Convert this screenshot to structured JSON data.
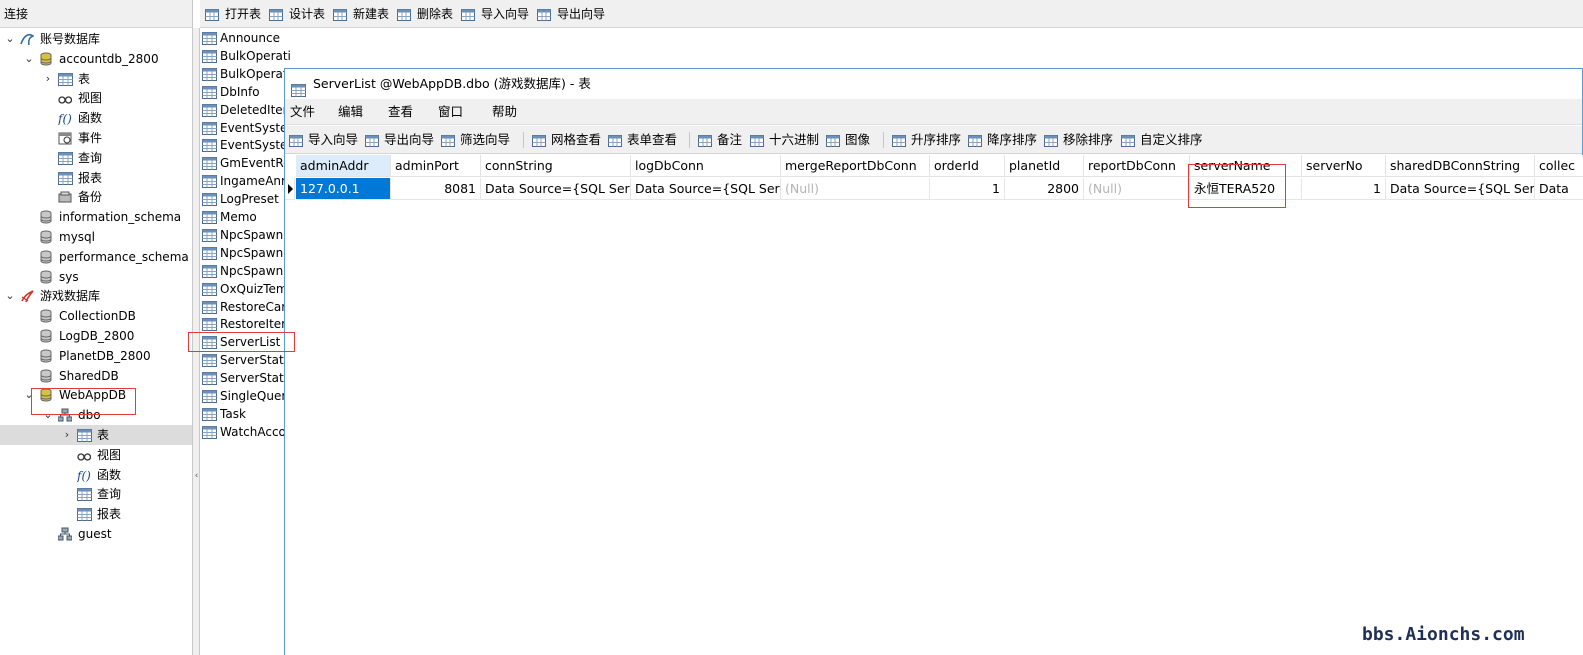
{
  "left_panel": {
    "header": "连接",
    "tree": [
      {
        "label": "账号数据库",
        "level": 0,
        "expanded": true,
        "icon": "mysql-connection-icon"
      },
      {
        "label": "accountdb_2800",
        "level": 1,
        "expanded": true,
        "icon": "database-open-icon"
      },
      {
        "label": "表",
        "level": 2,
        "expanded": false,
        "icon": "tables-icon"
      },
      {
        "label": "视图",
        "level": 2,
        "icon": "views-icon"
      },
      {
        "label": "函数",
        "level": 2,
        "icon": "functions-icon"
      },
      {
        "label": "事件",
        "level": 2,
        "icon": "events-icon"
      },
      {
        "label": "查询",
        "level": 2,
        "icon": "queries-icon"
      },
      {
        "label": "报表",
        "level": 2,
        "icon": "reports-icon"
      },
      {
        "label": "备份",
        "level": 2,
        "icon": "backups-icon"
      },
      {
        "label": "information_schema",
        "level": 1,
        "icon": "database-icon"
      },
      {
        "label": "mysql",
        "level": 1,
        "icon": "database-icon"
      },
      {
        "label": "performance_schema",
        "level": 1,
        "icon": "database-icon"
      },
      {
        "label": "sys",
        "level": 1,
        "icon": "database-icon"
      },
      {
        "label": "游戏数据库",
        "level": 0,
        "expanded": true,
        "icon": "sqlserver-connection-icon"
      },
      {
        "label": "CollectionDB",
        "level": 1,
        "icon": "database-icon"
      },
      {
        "label": "LogDB_2800",
        "level": 1,
        "icon": "database-icon"
      },
      {
        "label": "PlanetDB_2800",
        "level": 1,
        "icon": "database-icon"
      },
      {
        "label": "SharedDB",
        "level": 1,
        "icon": "database-icon"
      },
      {
        "label": "WebAppDB",
        "level": 1,
        "expanded": true,
        "icon": "database-open-icon"
      },
      {
        "label": "dbo",
        "level": 2,
        "expanded": true,
        "icon": "schema-icon"
      },
      {
        "label": "表",
        "level": 3,
        "expanded": false,
        "selected": true,
        "icon": "tables-icon"
      },
      {
        "label": "视图",
        "level": 3,
        "icon": "views-icon"
      },
      {
        "label": "函数",
        "level": 3,
        "icon": "functions-icon"
      },
      {
        "label": "查询",
        "level": 3,
        "icon": "queries-icon"
      },
      {
        "label": "报表",
        "level": 3,
        "icon": "reports-icon"
      },
      {
        "label": "guest",
        "level": 2,
        "icon": "schema-icon"
      }
    ]
  },
  "main_toolbar": [
    {
      "label": "打开表",
      "icon": "open-table-icon"
    },
    {
      "label": "设计表",
      "icon": "design-table-icon"
    },
    {
      "label": "新建表",
      "icon": "new-table-icon"
    },
    {
      "label": "删除表",
      "icon": "delete-table-icon"
    },
    {
      "label": "导入向导",
      "icon": "import-wizard-icon"
    },
    {
      "label": "导出向导",
      "icon": "export-wizard-icon"
    }
  ],
  "table_list": [
    "Announce",
    "BulkOperationFile",
    "BulkOperat",
    "DbInfo",
    "DeletedIter",
    "EventSyster",
    "EventSyster",
    "GmEventRe",
    "IngameAnr",
    "LogPreset",
    "Memo",
    "NpcSpawn",
    "NpcSpawn",
    "NpcSpawn",
    "OxQuizTem",
    "RestoreCar",
    "RestoreIter",
    "ServerList",
    "ServerStatu",
    "ServerStatu",
    "SingleQuer",
    "Task",
    "WatchAcco"
  ],
  "table_window": {
    "title": "ServerList @WebAppDB.dbo (游戏数据库) - 表",
    "menus": [
      "文件",
      "编辑",
      "查看",
      "窗口",
      "帮助"
    ],
    "toolbar": [
      {
        "label": "导入向导",
        "icon": "import-icon"
      },
      {
        "label": "导出向导",
        "icon": "export-icon"
      },
      {
        "label": "筛选向导",
        "icon": "filter-icon"
      },
      {
        "label": "网格查看",
        "icon": "grid-view-icon"
      },
      {
        "label": "表单查看",
        "icon": "form-view-icon"
      },
      {
        "label": "备注",
        "icon": "memo-icon"
      },
      {
        "label": "十六进制",
        "icon": "hex-icon"
      },
      {
        "label": "图像",
        "icon": "image-icon"
      },
      {
        "label": "升序排序",
        "icon": "sort-asc-icon"
      },
      {
        "label": "降序排序",
        "icon": "sort-desc-icon"
      },
      {
        "label": "移除排序",
        "icon": "remove-sort-icon"
      },
      {
        "label": "自定义排序",
        "icon": "custom-sort-icon"
      }
    ],
    "columns": [
      "adminAddr",
      "adminPort",
      "connString",
      "logDbConn",
      "mergeReportDbConn",
      "orderId",
      "planetId",
      "reportDbConn",
      "serverName",
      "serverNo",
      "sharedDBConnString",
      "collec"
    ],
    "row": [
      "127.0.0.1",
      "8081",
      "Data Source={SQL Server",
      "Data Source={SQL Server",
      "(Null)",
      "1",
      "2800",
      "(Null)",
      "永恒TERA520",
      "1",
      "Data Source={SQL Server",
      "Data"
    ]
  },
  "watermark": "bbs.Aionchs.com",
  "colors": {
    "selection": "#0078d7",
    "highlight_box": "#e23b3b",
    "header_first": "#dcecfb"
  }
}
